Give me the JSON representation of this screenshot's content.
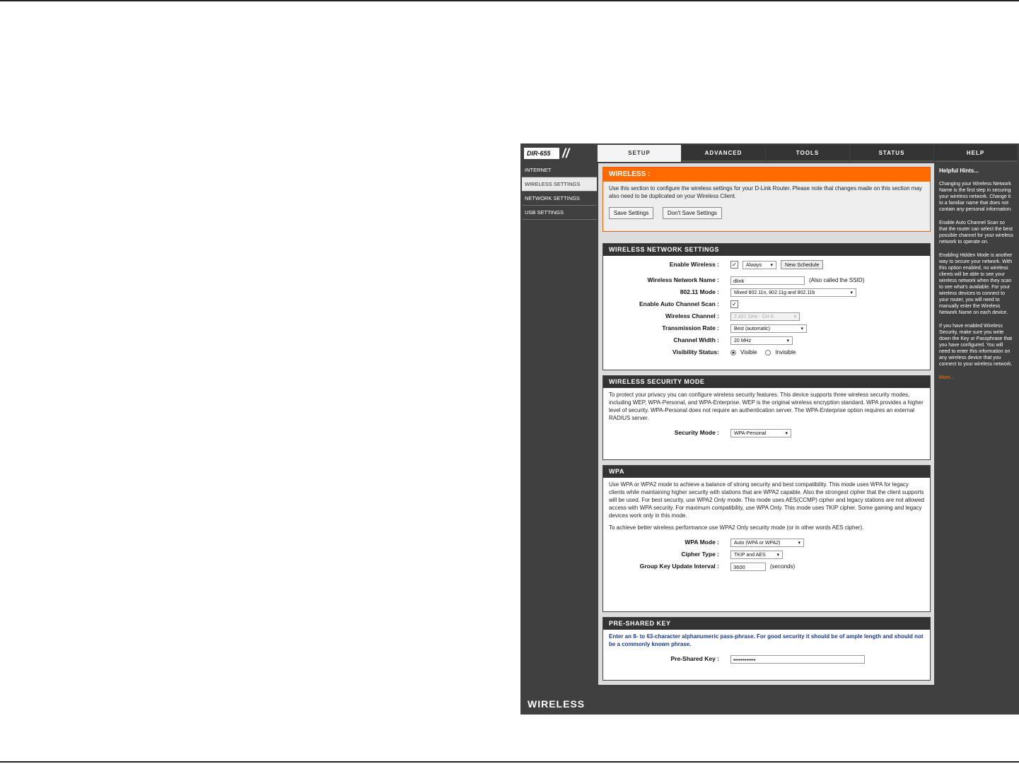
{
  "model": "DIR-655",
  "tabs": [
    "SETUP",
    "ADVANCED",
    "TOOLS",
    "STATUS",
    "HELP"
  ],
  "leftnav": [
    "INTERNET",
    "WIRELESS SETTINGS",
    "NETWORK SETTINGS",
    "USB SETTINGS"
  ],
  "footer_label": "WIRELESS",
  "wireless": {
    "title": "WIRELESS :",
    "desc": "Use this section to configure the wireless settings for your D-Link Router. Please note that changes made on this section may also need to be duplicated on your Wireless Client.",
    "save": "Save Settings",
    "dont_save": "Don't Save Settings"
  },
  "network": {
    "title": "WIRELESS NETWORK SETTINGS",
    "enable_label": "Enable Wireless :",
    "schedule": "Always",
    "new_schedule": "New Schedule",
    "ssid_label": "Wireless Network Name :",
    "ssid_value": "dlink",
    "ssid_note": "(Also called the SSID)",
    "mode_label": "802.11 Mode :",
    "mode_value": "Mixed 802.11n, 802.11g and 802.11b",
    "autoscan_label": "Enable Auto Channel Scan :",
    "channel_label": "Wireless Channel :",
    "channel_value": "2.437 GHz - CH 6",
    "rate_label": "Transmission Rate :",
    "rate_value": "Best (automatic)",
    "width_label": "Channel Width :",
    "width_value": "20 MHz",
    "visibility_label": "Visibility Status:",
    "visible": "Visible",
    "invisible": "Invisible"
  },
  "security": {
    "title": "WIRELESS SECURITY MODE",
    "desc": "To protect your privacy you can configure wireless security features. This device supports three wireless security modes, including WEP, WPA-Personal, and WPA-Enterprise. WEP is the original wireless encryption standard. WPA provides a higher level of security. WPA-Personal does not require an authentication server. The WPA-Enterprise option requires an external RADIUS server.",
    "mode_label": "Security Mode :",
    "mode_value": "WPA-Personal"
  },
  "wpa": {
    "title": "WPA",
    "desc1": "Use WPA or WPA2 mode to achieve a balance of strong security and best compatibility. This mode uses WPA for legacy clients while maintaining higher security with stations that are WPA2 capable. Also the strongest cipher that the client supports will be used. For best security, use WPA2 Only mode. This mode uses AES(CCMP) cipher and legacy stations are not allowed access with WPA security. For maximum compatibility, use WPA Only. This mode uses TKIP cipher. Some gaming and legacy devices work only in this mode.",
    "desc2": "To achieve better wireless performance use WPA2 Only security mode (or in other words AES cipher).",
    "mode_label": "WPA Mode :",
    "mode_value": "Auto (WPA or WPA2)",
    "cipher_label": "Cipher Type :",
    "cipher_value": "TKIP and AES",
    "interval_label": "Group Key Update Interval :",
    "interval_value": "3600",
    "interval_unit": "(seconds)"
  },
  "psk": {
    "title": "PRE-SHARED KEY",
    "desc": "Enter an 8- to 63-character alphanumeric pass-phrase. For good security it should be of ample length and should not be a commonly known phrase.",
    "key_label": "Pre-Shared Key :",
    "key_value": "••••••••••••"
  },
  "help": {
    "title": "Helpful Hints...",
    "p1": "Changing your Wireless Network Name is the first step in securing your wireless network. Change it to a familiar name that does not contain any personal information.",
    "p2": "Enable Auto Channel Scan so that the router can select the best possible channel for your wireless network to operate on.",
    "p3": "Enabling Hidden Mode is another way to secure your network. With this option enabled, no wireless clients will be able to see your wireless network when they scan to see what's available. For your wireless devices to connect to your router, you will need to manually enter the Wireless Network Name on each device.",
    "p4": "If you have enabled Wireless Security, make sure you write down the Key or Passphrase that you have configured. You will need to enter this information on any wireless device that you connect to your wireless network.",
    "more": "More..."
  }
}
